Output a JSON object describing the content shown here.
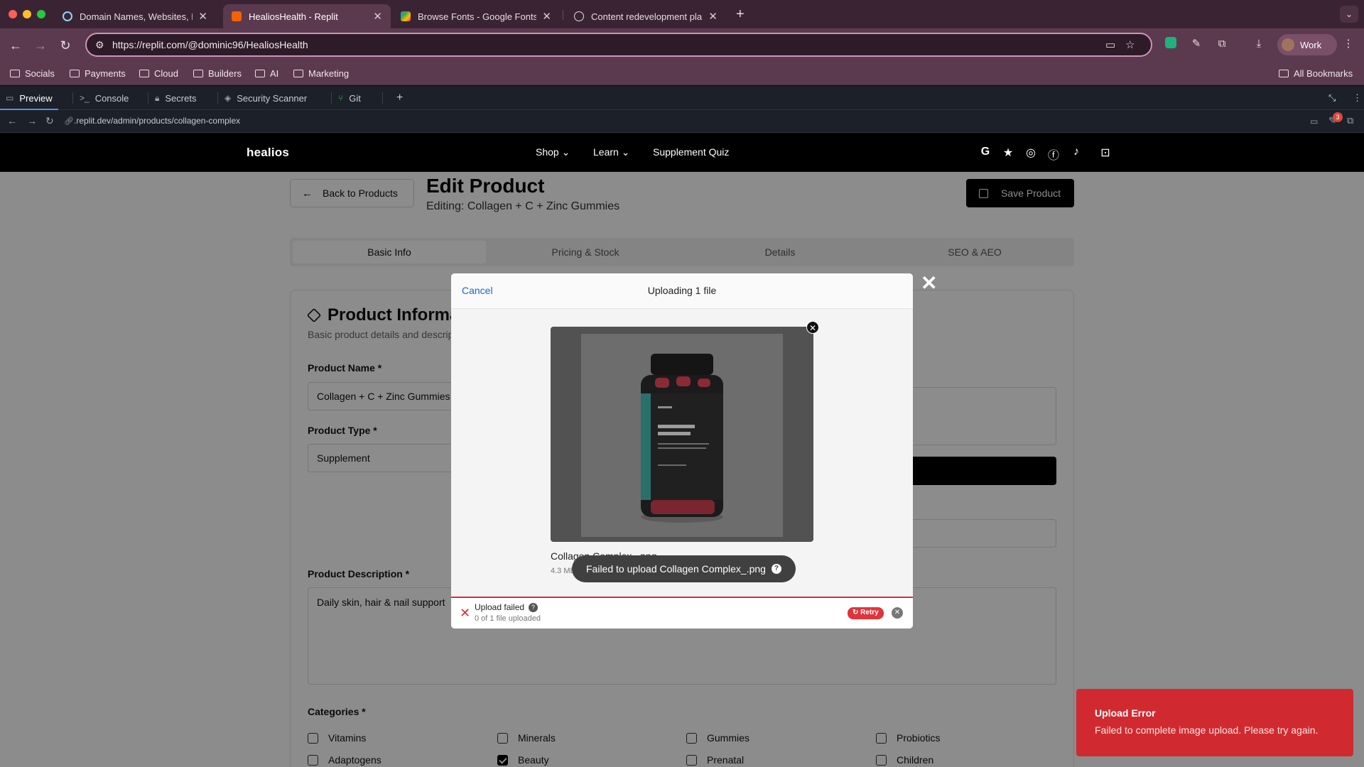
{
  "browser": {
    "tabs": [
      {
        "label": "Domain Names, Websites, Ho",
        "active": false
      },
      {
        "label": "HealiosHealth - Replit",
        "active": true
      },
      {
        "label": "Browse Fonts - Google Fonts",
        "active": false
      },
      {
        "label": "Content redevelopment plan",
        "active": false
      }
    ],
    "new_tab": "+",
    "url": "https://replit.com/@dominic96/HealiosHealth",
    "profile": "Work",
    "bookmarks": [
      "Socials",
      "Payments",
      "Cloud",
      "Builders",
      "AI",
      "Marketing"
    ],
    "all_bookmarks": "All Bookmarks"
  },
  "replit": {
    "tabs": [
      "Preview",
      "Console",
      "Secrets",
      "Security Scanner",
      "Git"
    ],
    "add": "+",
    "dev_url": ".replit.dev/admin/products/collagen-complex",
    "badge": "3"
  },
  "site": {
    "logo": "healios",
    "nav": [
      "Shop",
      "Learn",
      "Supplement Quiz"
    ],
    "back_label": "Back to Products",
    "title": "Edit Product",
    "subtitle": "Editing: Collagen + C + Zinc Gummies",
    "save_label": "Save Product",
    "tabs": [
      "Basic Info",
      "Pricing & Stock",
      "Details",
      "SEO & AEO"
    ],
    "card_title": "Product Information",
    "card_sub": "Basic product details and description",
    "product_name_label": "Product Name *",
    "product_name_value": "Collagen + C + Zinc Gummies",
    "product_type_label": "Product Type *",
    "product_type_value": "Supplement",
    "description_label": "Product Description *",
    "description_value": "Daily skin, hair & nail support",
    "categories_label": "Categories *",
    "categories": [
      {
        "label": "Vitamins",
        "checked": false
      },
      {
        "label": "Minerals",
        "checked": false
      },
      {
        "label": "Gummies",
        "checked": false
      },
      {
        "label": "Probiotics",
        "checked": false
      },
      {
        "label": "Adaptogens",
        "checked": false
      },
      {
        "label": "Beauty",
        "checked": true
      },
      {
        "label": "Prenatal",
        "checked": false
      },
      {
        "label": "Children",
        "checked": false
      }
    ]
  },
  "modal": {
    "cancel": "Cancel",
    "title": "Uploading 1 file",
    "file_name": "Collagen Complex_.png",
    "file_size": "4.3 MB",
    "tooltip": "Failed to upload Collagen Complex_.png",
    "status": "Upload failed",
    "status_sub": "0 of 1 file uploaded",
    "retry": "Retry"
  },
  "toast": {
    "title": "Upload Error",
    "message": "Failed to complete image upload. Please try again."
  },
  "colors": {
    "error": "#d02a30",
    "link": "#1269cf",
    "chrome": "#5b3a4f"
  }
}
